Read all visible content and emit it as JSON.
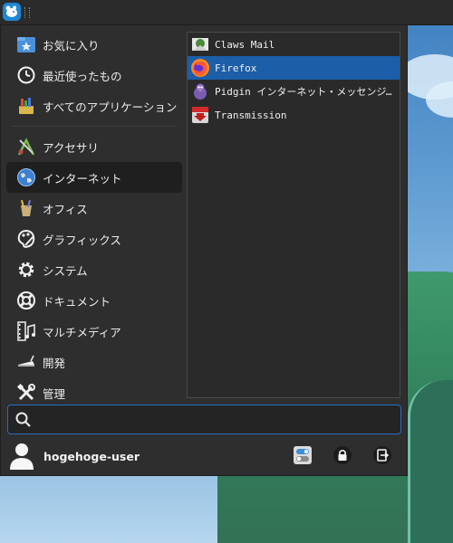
{
  "categories": [
    {
      "label": "お気に入り",
      "icon": "favorites-folder-icon"
    },
    {
      "label": "最近使ったもの",
      "icon": "clock-icon"
    },
    {
      "label": "すべてのアプリケーション",
      "icon": "all-applications-icon"
    },
    {
      "label": "アクセサリ",
      "icon": "accessories-icon"
    },
    {
      "label": "インターネット",
      "icon": "globe-icon",
      "active": true
    },
    {
      "label": "オフィス",
      "icon": "office-icon"
    },
    {
      "label": "グラフィックス",
      "icon": "palette-icon"
    },
    {
      "label": "システム",
      "icon": "gear-icon"
    },
    {
      "label": "ドキュメント",
      "icon": "lifebuoy-icon"
    },
    {
      "label": "マルチメディア",
      "icon": "multimedia-icon"
    },
    {
      "label": "開発",
      "icon": "development-icon"
    },
    {
      "label": "管理",
      "icon": "tools-icon"
    }
  ],
  "apps": [
    {
      "label": "Claws Mail",
      "icon": "claws-mail-icon"
    },
    {
      "label": "Firefox",
      "icon": "firefox-icon",
      "selected": true
    },
    {
      "label": "Pidgin インターネット・メッセンジャー",
      "icon": "pidgin-icon"
    },
    {
      "label": "Transmission",
      "icon": "transmission-icon"
    }
  ],
  "search": {
    "value": "",
    "placeholder": ""
  },
  "user": {
    "name": "hogehoge-user"
  },
  "colors": {
    "selection": "#1c5ea8",
    "search_border": "#2d6cc4",
    "menu_bg": "#2e2e2e"
  }
}
